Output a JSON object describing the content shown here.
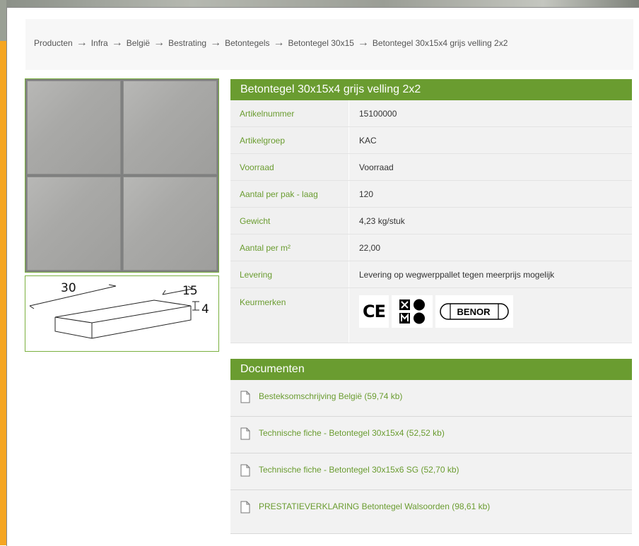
{
  "breadcrumb": [
    "Producten",
    "Infra",
    "België",
    "Bestrating",
    "Betontegels",
    "Betontegel 30x15",
    "Betontegel 30x15x4 grijs velling 2x2"
  ],
  "drawing": {
    "length": "30",
    "width": "15",
    "height": "4"
  },
  "product": {
    "title": "Betontegel 30x15x4 grijs velling 2x2",
    "specs": [
      {
        "label": "Artikelnummer",
        "value": "15100000"
      },
      {
        "label": "Artikelgroep",
        "value": "KAC"
      },
      {
        "label": "Voorraad",
        "value": "Voorraad"
      },
      {
        "label": "Aantal per pak - laag",
        "value": "120"
      },
      {
        "label": "Gewicht",
        "value": "4,23 kg/stuk"
      },
      {
        "label": "Aantal per m²",
        "value": "22,00"
      },
      {
        "label": "Levering",
        "value": "Levering op wegwerppallet tegen meerprijs mogelijk"
      }
    ],
    "certifications_label": "Keurmerken",
    "certifications": {
      "ce": "CE",
      "benor": "BENOR"
    }
  },
  "documents": {
    "title": "Documenten",
    "items": [
      "Besteksomschrijving België (59,74 kb)",
      "Technische fiche - Betontegel 30x15x4 (52,52 kb)",
      "Technische fiche - Betontegel 30x15x6 SG (52,70 kb)",
      "PRESTATIEVERKLARING Betontegel Walsoorden (98,61 kb)"
    ]
  },
  "colors": {
    "accent_green": "#6a9c30",
    "side_orange": "#f5a623"
  },
  "icons": {
    "document": "file-icon",
    "breadcrumb_separator": "arrow-right-icon"
  }
}
